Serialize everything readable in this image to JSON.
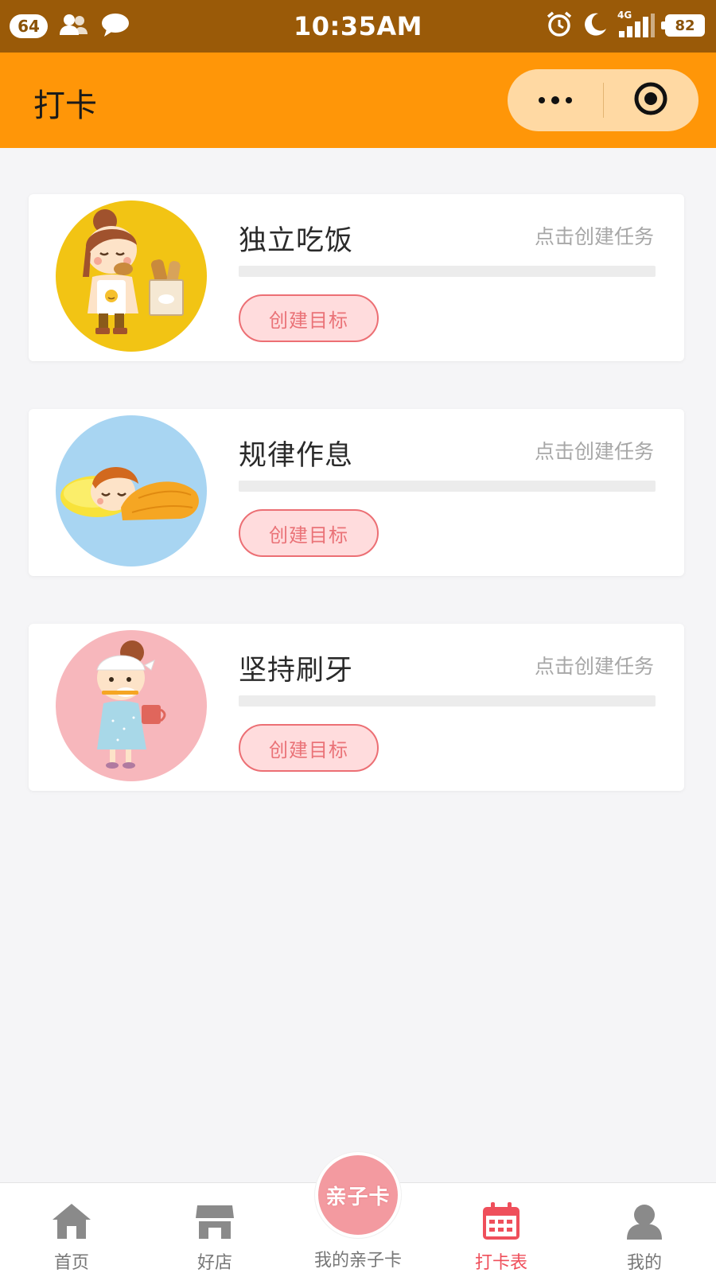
{
  "status_bar": {
    "notification_count": "64",
    "time": "10:35AM",
    "network": "4G",
    "battery": "82",
    "left_icons": [
      "contacts-icon",
      "chat-bubble-icon"
    ],
    "right_icons": [
      "alarm-icon",
      "moon-icon",
      "signal-icon",
      "battery-icon"
    ]
  },
  "nav": {
    "title": "打卡",
    "capsule_icons": [
      "more-dots-icon",
      "close-target-icon"
    ]
  },
  "cards": [
    {
      "title": "独立吃饭",
      "hint": "点击创建任务",
      "button_label": "创建目标",
      "progress": 0,
      "image": "girl-eating-bread",
      "avatar_bg": "#f2c414"
    },
    {
      "title": "规律作息",
      "hint": "点击创建任务",
      "button_label": "创建目标",
      "progress": 0,
      "image": "girl-sleeping",
      "avatar_bg": "#a8d5f2"
    },
    {
      "title": "坚持刷牙",
      "hint": "点击创建任务",
      "button_label": "创建目标",
      "progress": 0,
      "image": "girl-brushing-teeth",
      "avatar_bg": "#f7b7bc"
    }
  ],
  "tab_bar": {
    "home_label": "首页",
    "shop_label": "好店",
    "center_label": "我的亲子卡",
    "center_bubble_text": "亲子卡",
    "checkin_label": "打卡表",
    "me_label": "我的",
    "active_tab": "打卡表"
  },
  "colors": {
    "status_bar": "#9a5a08",
    "nav_bar": "#ff9608",
    "accent": "#ef4f5b",
    "button_border": "#ec6f74",
    "button_fill": "#ffdcdd",
    "page_bg": "#f5f5f7"
  }
}
